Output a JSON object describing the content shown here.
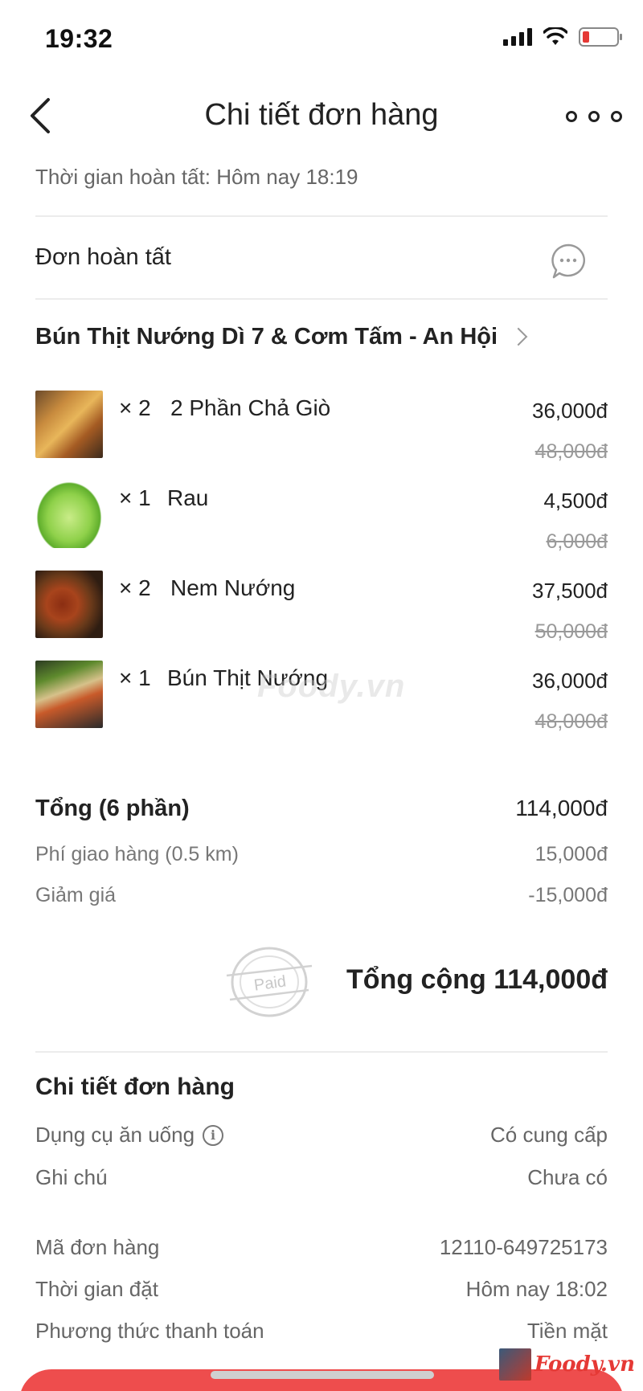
{
  "status_bar": {
    "time": "19:32"
  },
  "header": {
    "title": "Chi tiết đơn hàng"
  },
  "completion_time": "Thời gian hoàn tất: Hôm nay 18:19",
  "order_status": {
    "label": "Đơn hoàn tất"
  },
  "restaurant": {
    "name": "Bún Thịt Nướng Dì 7 & Cơm Tấm - An Hội"
  },
  "items": [
    {
      "qty": "× 2",
      "name": "2 Phần Chả Giò",
      "price": "36,000đ",
      "old_price": "48,000đ",
      "image": "spring-roll"
    },
    {
      "qty": "× 1",
      "name": "Rau",
      "price": "4,500đ",
      "old_price": "6,000đ",
      "image": "lettuce"
    },
    {
      "qty": "× 2",
      "name": "Nem Nướng",
      "price": "37,500đ",
      "old_price": "50,000đ",
      "image": "grilled-sausage"
    },
    {
      "qty": "× 1",
      "name": "Bún Thịt Nướng",
      "price": "36,000đ",
      "old_price": "48,000đ",
      "image": "vermicelli-bowl"
    }
  ],
  "watermark": "Foody.vn",
  "summary": {
    "subtotal_label": "Tổng (6 phần)",
    "subtotal_value": "114,000đ",
    "shipping_label": "Phí giao hàng (0.5 km)",
    "shipping_value": "15,000đ",
    "discount_label": "Giảm giá",
    "discount_value": "-15,000đ",
    "paid_stamp": "Paid",
    "grand_total": "Tổng cộng 114,000đ"
  },
  "details": {
    "title": "Chi tiết đơn hàng",
    "rows": [
      {
        "label": "Dụng cụ ăn uống",
        "value": "Có cung cấp"
      },
      {
        "label": "Ghi chú",
        "value": "Chưa có"
      },
      {
        "label": "Mã đơn hàng",
        "value": "12110-649725173"
      },
      {
        "label": "Thời gian đặt",
        "value": "Hôm nay 18:02"
      },
      {
        "label": "Phương thức thanh toán",
        "value": "Tiền mặt"
      }
    ]
  },
  "brand": {
    "logo_text": "Foody.vn"
  },
  "colors": {
    "accent": "#ee4d4d",
    "muted_text": "#777777",
    "strikethrough": "#999999"
  }
}
